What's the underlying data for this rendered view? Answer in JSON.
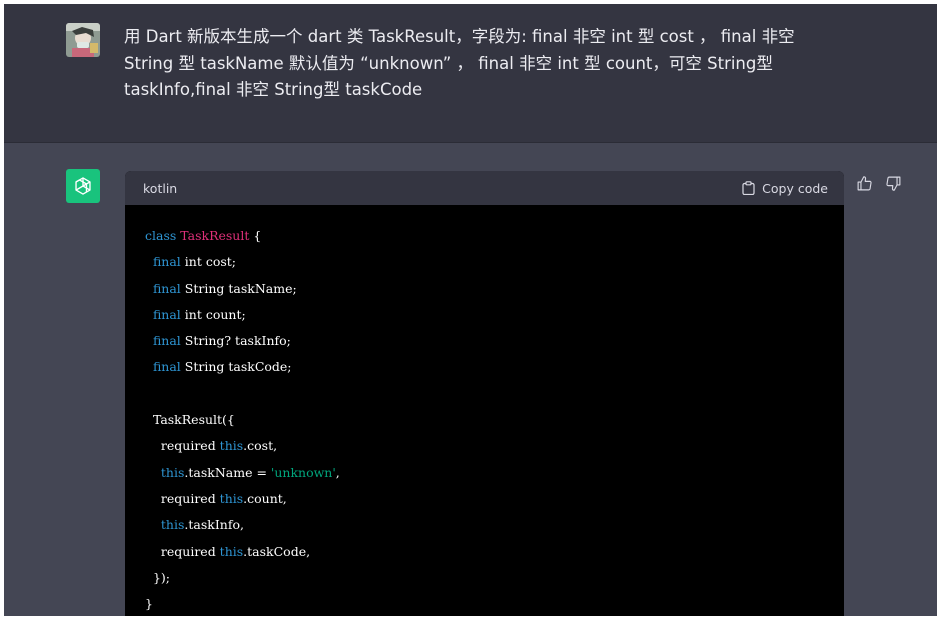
{
  "user_message": {
    "lines": [
      "用 Dart 新版本生成一个 dart 类 TaskResult，字段为: final 非空 int 型 cost ，  final 非空",
      "String 型 taskName 默认值为 “unknown” ，  final 非空 int 型 count，可空 String型",
      "taskInfo,final 非空 String型 taskCode"
    ]
  },
  "code_block": {
    "language": "kotlin",
    "copy_label": "Copy code",
    "lines": [
      [
        {
          "t": "class ",
          "c": "kw"
        },
        {
          "t": "TaskResult",
          "c": "cls"
        },
        {
          "t": " {",
          "c": ""
        }
      ],
      [
        {
          "t": "  ",
          "c": ""
        },
        {
          "t": "final",
          "c": "kw"
        },
        {
          "t": " int cost;",
          "c": ""
        }
      ],
      [
        {
          "t": "  ",
          "c": ""
        },
        {
          "t": "final",
          "c": "kw"
        },
        {
          "t": " String taskName;",
          "c": ""
        }
      ],
      [
        {
          "t": "  ",
          "c": ""
        },
        {
          "t": "final",
          "c": "kw"
        },
        {
          "t": " int count;",
          "c": ""
        }
      ],
      [
        {
          "t": "  ",
          "c": ""
        },
        {
          "t": "final",
          "c": "kw"
        },
        {
          "t": " String? taskInfo;",
          "c": ""
        }
      ],
      [
        {
          "t": "  ",
          "c": ""
        },
        {
          "t": "final",
          "c": "kw"
        },
        {
          "t": " String taskCode;",
          "c": ""
        }
      ],
      [],
      [
        {
          "t": "  TaskResult({",
          "c": ""
        }
      ],
      [
        {
          "t": "    required ",
          "c": ""
        },
        {
          "t": "this",
          "c": "kw"
        },
        {
          "t": ".cost,",
          "c": ""
        }
      ],
      [
        {
          "t": "    ",
          "c": ""
        },
        {
          "t": "this",
          "c": "kw"
        },
        {
          "t": ".taskName = ",
          "c": ""
        },
        {
          "t": "'unknown'",
          "c": "str"
        },
        {
          "t": ",",
          "c": ""
        }
      ],
      [
        {
          "t": "    required ",
          "c": ""
        },
        {
          "t": "this",
          "c": "kw"
        },
        {
          "t": ".count,",
          "c": ""
        }
      ],
      [
        {
          "t": "    ",
          "c": ""
        },
        {
          "t": "this",
          "c": "kw"
        },
        {
          "t": ".taskInfo,",
          "c": ""
        }
      ],
      [
        {
          "t": "    required ",
          "c": ""
        },
        {
          "t": "this",
          "c": "kw"
        },
        {
          "t": ".taskCode,",
          "c": ""
        }
      ],
      [
        {
          "t": "  });",
          "c": ""
        }
      ],
      [
        {
          "t": "}",
          "c": ""
        }
      ]
    ]
  },
  "icons": {
    "user_avatar": "user-avatar-image",
    "assistant_avatar": "openai-logo-icon",
    "copy": "clipboard-icon",
    "thumbs_up": "thumbs-up-icon",
    "thumbs_down": "thumbs-down-icon"
  },
  "colors": {
    "user_row_bg": "#343541",
    "assistant_row_bg": "#444654",
    "assistant_avatar_bg": "#19c37d",
    "code_bg": "#000000",
    "keyword": "#2e95d3",
    "class_name": "#df3079",
    "string": "#00a67d"
  }
}
